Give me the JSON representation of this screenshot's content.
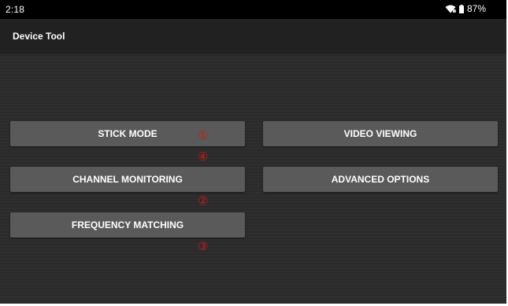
{
  "status_bar": {
    "time": "2:18",
    "battery": "87%",
    "icons": [
      "wifi-icon",
      "battery-icon"
    ]
  },
  "app_bar": {
    "title": "Device Tool"
  },
  "buttons": {
    "stick_mode": "STICK MODE",
    "video_viewing": "VIDEO VIEWING",
    "channel_monitoring": "CHANNEL MONITORING",
    "advanced_options": "ADVANCED OPTIONS",
    "frequency_matching": "FREQUENCY MATCHING"
  },
  "annotations": {
    "marker_1": "①",
    "marker_4": "④",
    "marker_2": "②",
    "marker_3": "③"
  },
  "colors": {
    "background": "#2b2b2b",
    "status_bar": "#000000",
    "app_bar": "#212121",
    "button": "#5a5a5a",
    "annotation": "#d01818"
  }
}
